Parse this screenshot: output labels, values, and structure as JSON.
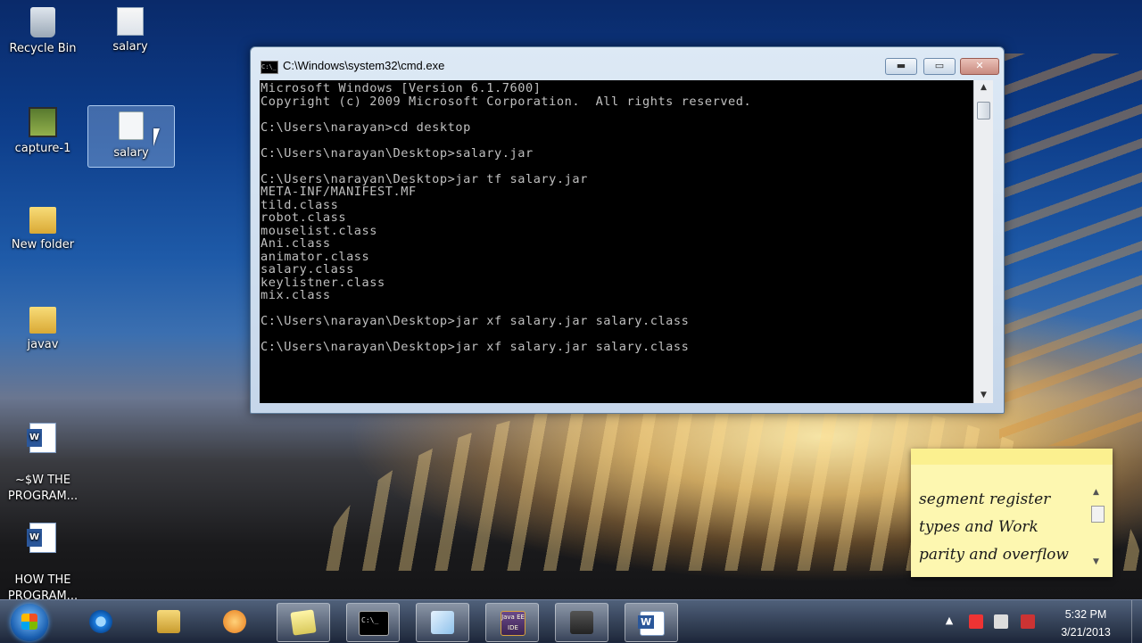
{
  "desktop": {
    "icons": [
      {
        "label": "Recycle Bin"
      },
      {
        "label": "salary"
      },
      {
        "label": "capture-1"
      },
      {
        "label": "salary"
      },
      {
        "label": "New folder"
      },
      {
        "label": "javav"
      },
      {
        "label": "~$W THE\nPROGRAM..."
      },
      {
        "label": "HOW THE\nPROGRAM..."
      }
    ]
  },
  "cmd_window": {
    "title": "C:\\Windows\\system32\\cmd.exe",
    "icon_text": "C:\\_",
    "controls": {
      "minimize": "▬",
      "maximize": "▭",
      "close": "✕"
    },
    "output": "Microsoft Windows [Version 6.1.7600]\nCopyright (c) 2009 Microsoft Corporation.  All rights reserved.\n\nC:\\Users\\narayan>cd desktop\n\nC:\\Users\\narayan\\Desktop>salary.jar\n\nC:\\Users\\narayan\\Desktop>jar tf salary.jar\nMETA-INF/MANIFEST.MF\ntild.class\nrobot.class\nmouselist.class\nAni.class\nanimator.class\nsalary.class\nkeylistner.class\nmix.class\n\nC:\\Users\\narayan\\Desktop>jar xf salary.jar salary.class\n\nC:\\Users\\narayan\\Desktop>jar xf salary.jar salary.class",
    "scroll_up": "▲",
    "scroll_down": "▼"
  },
  "sticky_note": {
    "lines": [
      "segment register",
      "types and Work",
      "parity and overflow"
    ],
    "scroll_up": "▲",
    "scroll_down": "▼"
  },
  "taskbar": {
    "pinned": [
      {
        "icon": "internet-explorer-icon"
      },
      {
        "icon": "windows-explorer-icon"
      },
      {
        "icon": "media-player-icon"
      },
      {
        "icon": "sticky-notes-icon"
      },
      {
        "icon": "command-prompt-icon",
        "text": "C:\\_"
      },
      {
        "icon": "glass-window-icon"
      },
      {
        "icon": "java-ee-ide-icon",
        "text": "Java EE IDE"
      },
      {
        "icon": "video-camera-icon"
      },
      {
        "icon": "word-icon"
      }
    ],
    "tray": {
      "show_hidden": "▲"
    },
    "clock": {
      "time": "5:32 PM",
      "date": "3/21/2013"
    }
  }
}
